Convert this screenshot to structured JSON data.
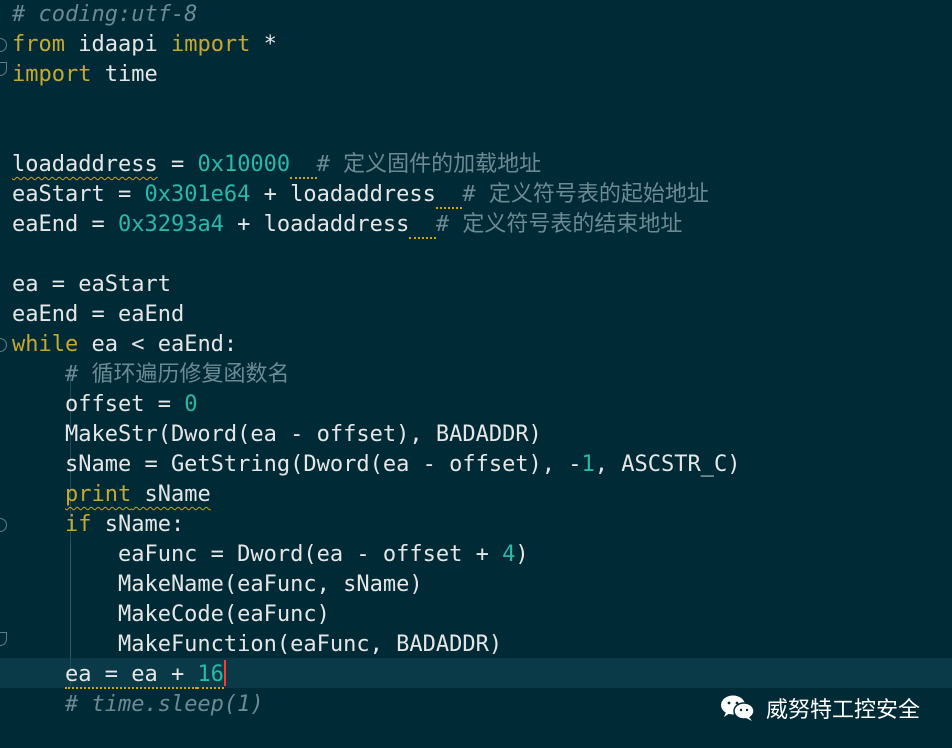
{
  "editor": {
    "lines": [
      {
        "tokens": [
          {
            "t": "# coding:utf-8",
            "c": "cmti"
          }
        ]
      },
      {
        "tokens": [
          {
            "t": "from",
            "c": "kw"
          },
          {
            "t": " idaapi ",
            "c": "id"
          },
          {
            "t": "import",
            "c": "kw"
          },
          {
            "t": " *",
            "c": "id"
          }
        ]
      },
      {
        "tokens": [
          {
            "t": "import",
            "c": "kw"
          },
          {
            "t": " time",
            "c": "id"
          }
        ]
      },
      {
        "tokens": []
      },
      {
        "tokens": []
      },
      {
        "tokens": [
          {
            "t": "loadaddress",
            "c": "id squiggle"
          },
          {
            "t": " = ",
            "c": "id"
          },
          {
            "t": "0x10000",
            "c": "num"
          },
          {
            "t": "  ",
            "c": "dotted"
          },
          {
            "t": "# 定义固件的加载地址",
            "c": "cmt"
          }
        ]
      },
      {
        "tokens": [
          {
            "t": "eaStart = ",
            "c": "id"
          },
          {
            "t": "0x301e64",
            "c": "num"
          },
          {
            "t": " + loadaddress",
            "c": "id"
          },
          {
            "t": "  ",
            "c": "dotted"
          },
          {
            "t": "# 定义符号表的起始地址",
            "c": "cmt"
          }
        ]
      },
      {
        "tokens": [
          {
            "t": "eaEnd = ",
            "c": "id"
          },
          {
            "t": "0x3293a4",
            "c": "num"
          },
          {
            "t": " + loadaddress",
            "c": "id"
          },
          {
            "t": "  ",
            "c": "dotted"
          },
          {
            "t": "# 定义符号表的结束地址",
            "c": "cmt"
          }
        ]
      },
      {
        "tokens": []
      },
      {
        "tokens": [
          {
            "t": "ea = eaStart",
            "c": "id"
          }
        ]
      },
      {
        "tokens": [
          {
            "t": "eaEnd = eaEnd",
            "c": "id"
          }
        ]
      },
      {
        "tokens": [
          {
            "t": "while",
            "c": "kw"
          },
          {
            "t": " ea < eaEnd:",
            "c": "id"
          }
        ]
      },
      {
        "tokens": [
          {
            "t": "    ",
            "c": "id"
          },
          {
            "t": "# 循环遍历修复函数名",
            "c": "cmt"
          }
        ]
      },
      {
        "tokens": [
          {
            "t": "    offset = ",
            "c": "id"
          },
          {
            "t": "0",
            "c": "num"
          }
        ]
      },
      {
        "tokens": [
          {
            "t": "    MakeStr(Dword(ea - offset), BADADDR)",
            "c": "id"
          }
        ]
      },
      {
        "tokens": [
          {
            "t": "    sName = GetString(Dword(ea - offset), -",
            "c": "id"
          },
          {
            "t": "1",
            "c": "num"
          },
          {
            "t": ", ASCSTR_C)",
            "c": "id"
          }
        ]
      },
      {
        "tokens": [
          {
            "t": "    ",
            "c": "id"
          },
          {
            "t": "print",
            "c": "kw squiggle"
          },
          {
            "t": " sName",
            "c": "id squiggle"
          }
        ]
      },
      {
        "tokens": [
          {
            "t": "    ",
            "c": "id"
          },
          {
            "t": "if",
            "c": "kw"
          },
          {
            "t": " sName:",
            "c": "id"
          }
        ]
      },
      {
        "tokens": [
          {
            "t": "        eaFunc = Dword(ea - offset + ",
            "c": "id"
          },
          {
            "t": "4",
            "c": "num"
          },
          {
            "t": ")",
            "c": "id"
          }
        ]
      },
      {
        "tokens": [
          {
            "t": "        MakeName(eaFunc, sName)",
            "c": "id"
          }
        ]
      },
      {
        "tokens": [
          {
            "t": "        MakeCode(eaFunc)",
            "c": "id"
          }
        ]
      },
      {
        "tokens": [
          {
            "t": "        MakeFunction(eaFunc, BADADDR)",
            "c": "id"
          }
        ]
      },
      {
        "tokens": [
          {
            "t": "    ",
            "c": "id"
          },
          {
            "t": "ea = ea + ",
            "c": "id dotted"
          },
          {
            "t": "16",
            "c": "num dotted"
          }
        ],
        "cursor": true
      },
      {
        "tokens": [
          {
            "t": "    ",
            "c": "id"
          },
          {
            "t": "# time.sleep(1)",
            "c": "cmti"
          }
        ]
      }
    ]
  },
  "watermark": {
    "icon": "wechat-icon",
    "text": "威努特工控安全"
  },
  "colors": {
    "background": "#002b36",
    "keyword": "#c5a832",
    "number": "#2ab8a8",
    "comment": "#6b8a93",
    "identifier": "#e6e6e6",
    "cursor": "#ff3b30"
  }
}
